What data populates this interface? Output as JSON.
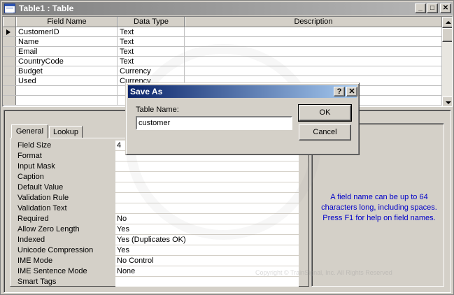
{
  "window": {
    "title": "Table1 : Table",
    "minimize_glyph": "_",
    "maximize_glyph": "□",
    "close_glyph": "✕"
  },
  "grid": {
    "columns": [
      "Field Name",
      "Data Type",
      "Description"
    ],
    "rows": [
      {
        "field": "CustomerID",
        "type": "Text",
        "description": ""
      },
      {
        "field": "Name",
        "type": "Text",
        "description": ""
      },
      {
        "field": "Email",
        "type": "Text",
        "description": ""
      },
      {
        "field": "CountryCode",
        "type": "Text",
        "description": ""
      },
      {
        "field": "Budget",
        "type": "Currency",
        "description": ""
      },
      {
        "field": "Used",
        "type": "Currency",
        "description": ""
      }
    ]
  },
  "properties": {
    "tabs": [
      "General",
      "Lookup"
    ],
    "items": [
      {
        "label": "Field Size",
        "value": "4"
      },
      {
        "label": "Format",
        "value": ""
      },
      {
        "label": "Input Mask",
        "value": ""
      },
      {
        "label": "Caption",
        "value": ""
      },
      {
        "label": "Default Value",
        "value": ""
      },
      {
        "label": "Validation Rule",
        "value": ""
      },
      {
        "label": "Validation Text",
        "value": ""
      },
      {
        "label": "Required",
        "value": "No"
      },
      {
        "label": "Allow Zero Length",
        "value": "Yes"
      },
      {
        "label": "Indexed",
        "value": "Yes (Duplicates OK)"
      },
      {
        "label": "Unicode Compression",
        "value": "Yes"
      },
      {
        "label": "IME Mode",
        "value": "No Control"
      },
      {
        "label": "IME Sentence Mode",
        "value": "None"
      },
      {
        "label": "Smart Tags",
        "value": ""
      }
    ],
    "help_text": "A field name can be up to 64 characters long, including spaces. Press F1 for help on field names."
  },
  "watermark": {
    "ring_text": "TRAINSIGNIATE",
    "copyright": "Copyright © TrainSignal, Inc. All Rights Reserved"
  },
  "dialog": {
    "title": "Save As",
    "help_glyph": "?",
    "close_glyph": "✕",
    "table_name_label": "Table Name:",
    "table_name_value": "customer",
    "ok_label": "OK",
    "cancel_label": "Cancel"
  },
  "colors": {
    "dialog_title_start": "#0a246a",
    "dialog_title_end": "#a6caf0",
    "help_text": "#0000c8",
    "face": "#d4d0c8"
  }
}
